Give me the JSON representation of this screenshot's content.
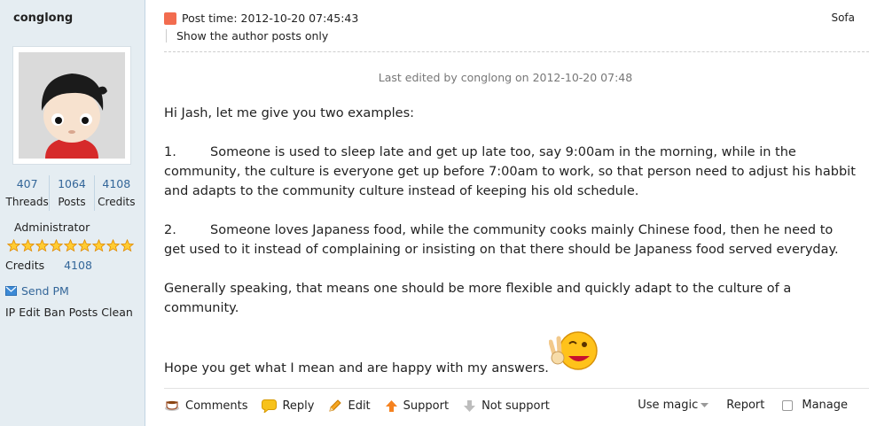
{
  "author": {
    "name": "conglong",
    "stats": [
      {
        "num": "407",
        "label": "Threads"
      },
      {
        "num": "1064",
        "label": "Posts"
      },
      {
        "num": "4108",
        "label": "Credits"
      }
    ],
    "role": "Administrator",
    "stars": 9,
    "credits_label": "Credits",
    "credits_value": "4108",
    "send_pm": "Send PM",
    "admin_links": [
      "IP",
      "Edit",
      "Ban",
      "Posts",
      "Clean"
    ]
  },
  "post": {
    "time": "Post time: 2012-10-20 07:45:43",
    "author_only": "Show the author posts only",
    "floor": "Sofa",
    "edited": "Last edited by conglong on 2012-10-20 07:48",
    "greeting": "Hi Jash, let me give you two examples:",
    "item1_num": "1.",
    "item1_text": "Someone is used to sleep late and get up late too, say 9:00am in the morning, while in the community, the culture is everyone get up before 7:00am to work, so that person need to adjust his habbit and adapts to the community culture instead of keeping his old schedule.",
    "item2_num": "2.",
    "item2_text": "Someone loves Japaness food, while the community cooks mainly Chinese food, then he need to get used to it instead of complaining or insisting on that there should be Japaness food served everyday.",
    "summary": "Generally speaking, that means one should be more flexible and quickly adapt to the culture of a community.",
    "closing": "Hope you get what I mean and are happy with my answers."
  },
  "actions": {
    "comments": "Comments",
    "reply": "Reply",
    "edit": "Edit",
    "support": "Support",
    "not_support": "Not support",
    "use_magic": "Use magic",
    "report": "Report",
    "manage": "Manage"
  }
}
